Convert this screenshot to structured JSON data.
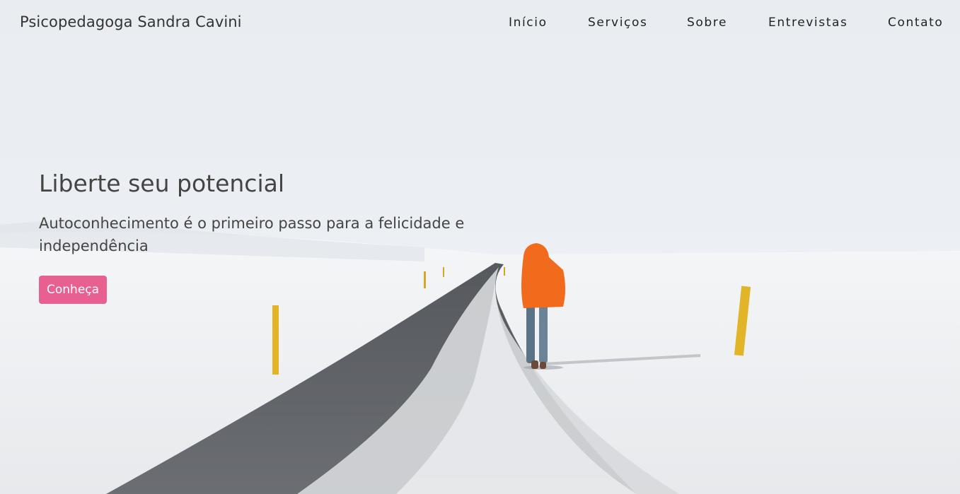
{
  "navbar": {
    "brand": "Psicopedagoga Sandra Cavini",
    "items": [
      {
        "label": "Início"
      },
      {
        "label": "Serviços"
      },
      {
        "label": "Sobre"
      },
      {
        "label": "Entrevistas"
      },
      {
        "label": "Contato"
      }
    ]
  },
  "hero": {
    "headline": "Liberte seu potencial",
    "subheadline": "Autoconhecimento é o primeiro passo para a felicidade e independência",
    "cta_label": "Conheça",
    "background_image": "snowy-road-person-walking",
    "accent_color": "#e8608f"
  }
}
